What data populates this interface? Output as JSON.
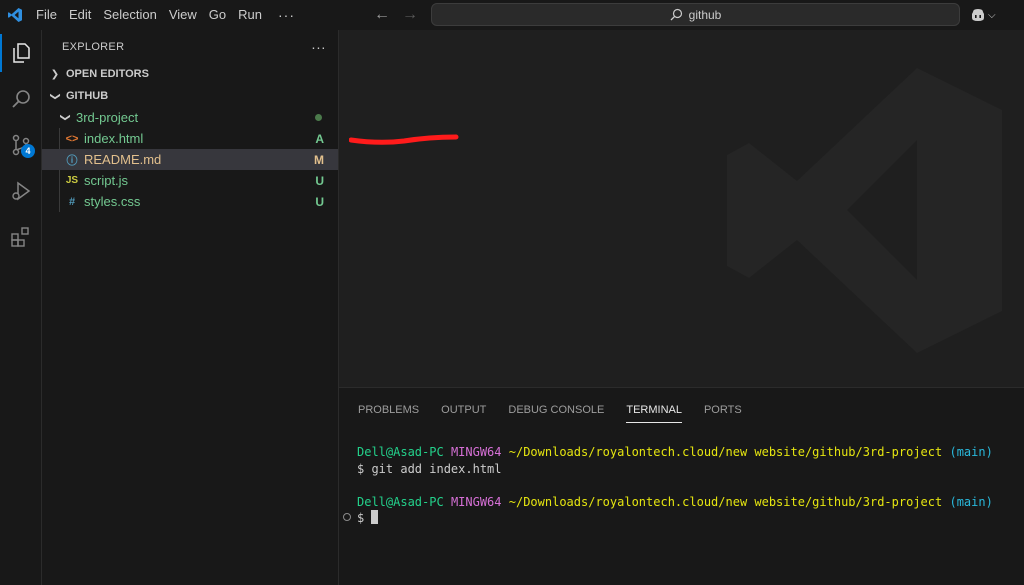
{
  "menu": {
    "items": [
      "File",
      "Edit",
      "Selection",
      "View",
      "Go",
      "Run"
    ],
    "more": "···"
  },
  "search": {
    "text": "github",
    "icon": "search-icon"
  },
  "activity": {
    "items": [
      "explorer-icon",
      "search-icon",
      "source-control-icon",
      "run-debug-icon",
      "extensions-icon"
    ],
    "source_control_badge": "4"
  },
  "explorer": {
    "title": "EXPLORER",
    "more": "···",
    "open_editors": "OPEN EDITORS",
    "workspace": "GITHUB",
    "folder": "3rd-project",
    "files": [
      {
        "icon": "<>",
        "name": "index.html",
        "status": "A",
        "name_color": "#73c991",
        "icon_color": "#e37933",
        "status_color": "#73c991"
      },
      {
        "icon": "ⓘ",
        "name": "README.md",
        "status": "M",
        "name_color": "#e2c08d",
        "icon_color": "#519aba",
        "status_color": "#e2c08d"
      },
      {
        "icon": "JS",
        "name": "script.js",
        "status": "U",
        "name_color": "#73c991",
        "icon_color": "#cbcb41",
        "status_color": "#73c991"
      },
      {
        "icon": "#",
        "name": "styles.css",
        "status": "U",
        "name_color": "#73c991",
        "icon_color": "#519aba",
        "status_color": "#73c991"
      }
    ]
  },
  "panel": {
    "tabs": [
      "PROBLEMS",
      "OUTPUT",
      "DEBUG CONSOLE",
      "TERMINAL",
      "PORTS"
    ],
    "active_tab": "TERMINAL"
  },
  "terminal": {
    "user": "Dell@Asad-PC",
    "env": "MINGW64",
    "path": "~/Downloads/royalontech.cloud/new website/github/3rd-project",
    "branch": "(main)",
    "command": "$ git add index.html",
    "prompt": "$ "
  }
}
